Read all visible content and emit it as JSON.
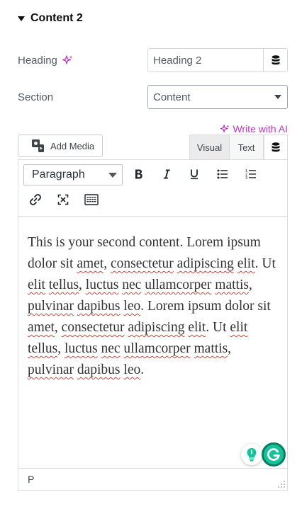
{
  "section": {
    "title": "Content 2"
  },
  "heading_field": {
    "label": "Heading",
    "value": "Heading 2"
  },
  "section_field": {
    "label": "Section",
    "selected": "Content"
  },
  "write_with_ai": "Write with AI",
  "add_media": "Add Media",
  "editor": {
    "tabs": {
      "visual": "Visual",
      "text": "Text"
    },
    "format": "Paragraph",
    "content": [
      {
        "t": "This is your second content. Lorem ipsum dolor sit "
      },
      {
        "t": "amet",
        "spell": true
      },
      {
        "t": ", "
      },
      {
        "t": "consectetur",
        "spell": true
      },
      {
        "t": " "
      },
      {
        "t": "adipiscing",
        "spell": true
      },
      {
        "t": " "
      },
      {
        "t": "elit",
        "spell": true
      },
      {
        "t": ". Ut "
      },
      {
        "t": "elit",
        "spell": true
      },
      {
        "t": " "
      },
      {
        "t": "tellus",
        "spell": true
      },
      {
        "t": ", "
      },
      {
        "t": "luctus",
        "spell": true
      },
      {
        "t": " "
      },
      {
        "t": "nec",
        "spell": true
      },
      {
        "t": " "
      },
      {
        "t": "ullamcorper",
        "spell": true
      },
      {
        "t": " "
      },
      {
        "t": "mattis",
        "spell": true
      },
      {
        "t": ", "
      },
      {
        "t": "pulvinar",
        "spell": true
      },
      {
        "t": " "
      },
      {
        "t": "dapibus",
        "spell": true
      },
      {
        "t": " "
      },
      {
        "t": "leo",
        "spell": true
      },
      {
        "t": ". Lorem ipsum dolor sit "
      },
      {
        "t": "amet",
        "spell": true
      },
      {
        "t": ", "
      },
      {
        "t": "consectetur",
        "spell": true
      },
      {
        "t": " "
      },
      {
        "t": "adipiscing",
        "spell": true
      },
      {
        "t": " "
      },
      {
        "t": "elit",
        "spell": true
      },
      {
        "t": ". Ut "
      },
      {
        "t": "elit",
        "spell": true
      },
      {
        "t": " "
      },
      {
        "t": "tellus",
        "spell": true
      },
      {
        "t": ", "
      },
      {
        "t": "luctus",
        "spell": true
      },
      {
        "t": " "
      },
      {
        "t": "nec",
        "spell": true
      },
      {
        "t": " "
      },
      {
        "t": "ullamcorper",
        "spell": true
      },
      {
        "t": " "
      },
      {
        "t": "mattis",
        "spell": true
      },
      {
        "t": ", "
      },
      {
        "t": "pulvinar",
        "spell": true
      },
      {
        "t": " "
      },
      {
        "t": "dapibus",
        "spell": true
      },
      {
        "t": " "
      },
      {
        "t": "leo",
        "spell": true
      },
      {
        "t": "."
      }
    ],
    "status_path": "P"
  },
  "icons": {
    "ai_sparkle": "sparkle-icon",
    "dynamic_tags": "database-icon",
    "add_media": "add-media-icon",
    "bold": "bold-icon",
    "italic": "italic-icon",
    "underline": "underline-icon",
    "bullet_list": "bullet-list-icon",
    "numbered_list": "numbered-list-icon",
    "link": "link-icon",
    "fullscreen": "fullscreen-icon",
    "keyboard": "keyboard-icon",
    "grammarly_suggestion": "lightbulb-icon",
    "grammarly": "grammarly-icon"
  },
  "colors": {
    "ai_accent": "#c036c0",
    "grammarly": "#15c39a",
    "spell_error": "#e33a3a"
  }
}
